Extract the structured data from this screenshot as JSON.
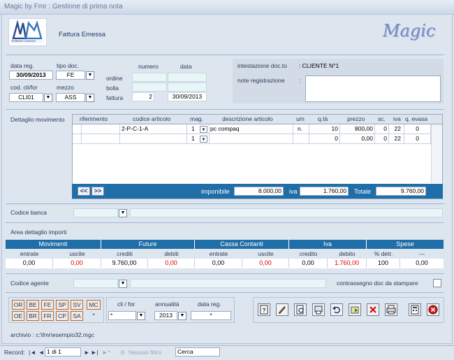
{
  "window": {
    "title": "Magic by Fmr : Gestione di prima nota"
  },
  "header": {
    "logo_text": "Software d'autore",
    "doc_type": "Fattura Emessa",
    "brand": "Magic"
  },
  "docfields": {
    "data_reg_label": "data reg.",
    "data_reg": "30/09/2013",
    "tipo_doc_label": "tipo doc.",
    "tipo_doc": "FE",
    "cod_label": "cod. cli/for",
    "cod": "CLI01",
    "mezzo_label": "mezzo",
    "mezzo": "ASS",
    "numero_label": "numero",
    "data_label": "data",
    "ordine_label": "ordine",
    "bolla_label": "bolla",
    "fattura_label": "fattura",
    "fattura_numero": "2",
    "fattura_data": "30/09/2013",
    "intestazione_label": "intestazione doc.to",
    "intestazione": ": CLIENTE N°1",
    "note_label": "note registrazione",
    "note_colon": ":"
  },
  "dettaglio": {
    "label": "Dettaglio movimento",
    "headers": [
      "riferimento",
      "codice articolo",
      "mag.",
      "descrizione articolo",
      "um",
      "q.tà",
      "prezzo",
      "sc.",
      "iva",
      "q. evasa"
    ],
    "rows": [
      {
        "riferimento": "",
        "codice": "2-P-C-1-A",
        "mag": "1",
        "descrizione": "pc compaq",
        "um": "n.",
        "qta": "10",
        "prezzo": "800,00",
        "sc": "0",
        "iva": "22",
        "evasa": "0"
      },
      {
        "riferimento": "",
        "codice": "",
        "mag": "1",
        "descrizione": "",
        "um": "",
        "qta": "0",
        "prezzo": "0,00",
        "sc": "0",
        "iva": "22",
        "evasa": "0"
      }
    ],
    "prev_label": "<<",
    "next_label": ">>",
    "imponibile_label": "imponibile",
    "imponibile": "8.000,00",
    "iva_label": "iva",
    "iva": "1.760,00",
    "totale_label": "Totale",
    "totale": "9.760,00"
  },
  "banca": {
    "label": "Codice banca"
  },
  "importi": {
    "title": "Area dettaglio importi",
    "groups": [
      "Movimenti",
      "Future",
      "Cassa Contanti",
      "Iva",
      "Spese"
    ],
    "subheaders": [
      "entrate",
      "uscite",
      "crediti",
      "debiti",
      "entrate",
      "uscite",
      "credito",
      "debito",
      "% detr.",
      "---"
    ],
    "values": [
      "0,00",
      "0,00",
      "9.760,00",
      "0,00",
      "0,00",
      "0,00",
      "0,00",
      "1.760,00",
      "100",
      "0,00"
    ]
  },
  "agente": {
    "label": "Codice agente",
    "contrassegno_label": "contrassegno doc da stampare"
  },
  "filtri": {
    "letters_row1": [
      "OR",
      "BE",
      "FE",
      "SP",
      "SV",
      "MC"
    ],
    "letters_row2": [
      "OE",
      "BR",
      "FR",
      "CP",
      "SA",
      "*"
    ],
    "clifor_label": "cli / for",
    "clifor": "*",
    "annualita_label": "annualità",
    "annualita": "2013",
    "datareg_label": "data reg.",
    "datareg": "*"
  },
  "archivio": "archivio : c:\\fmr\\esempio32.mgc",
  "toolbar": {
    "icons": [
      "help-icon",
      "edit-icon",
      "preview-icon",
      "print-setup-icon",
      "undo-icon",
      "add-record-icon",
      "delete-icon",
      "print-icon",
      "calculator-icon",
      "close-icon"
    ]
  },
  "status": {
    "record_label": "Record:",
    "record_pos": "1 di 1",
    "filter_label": "Nessun filtro",
    "search": "Cerca"
  },
  "colors": {
    "accent": "#1f6ea8",
    "negative": "#e00000"
  }
}
